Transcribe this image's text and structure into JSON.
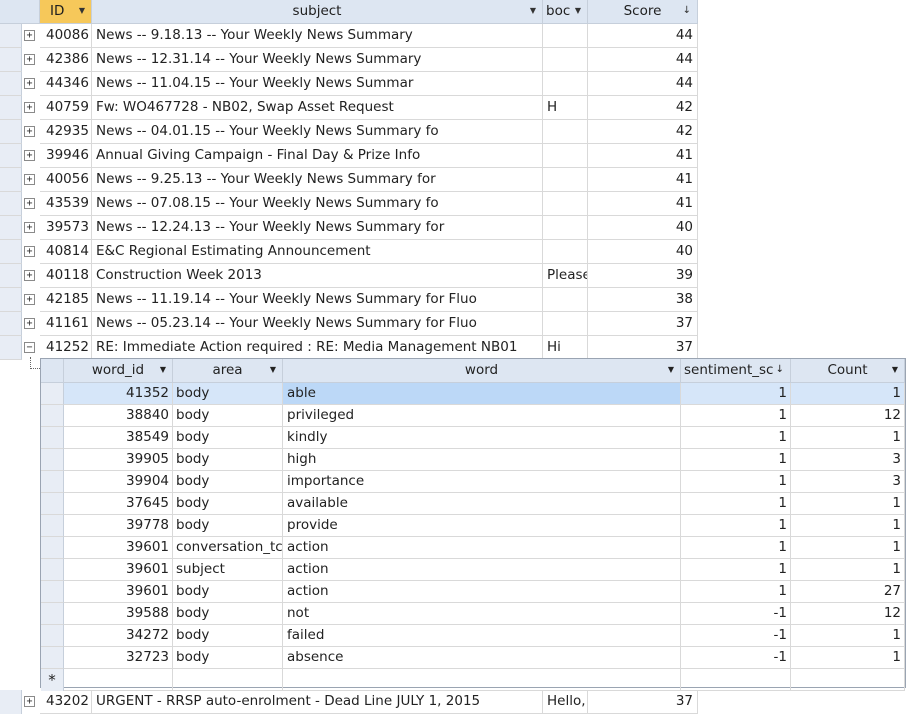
{
  "main": {
    "columns": [
      {
        "key": "id",
        "label": "ID",
        "sort": "▾"
      },
      {
        "key": "subject",
        "label": "subject",
        "sort": "▾"
      },
      {
        "key": "body",
        "label": "boc",
        "sort": "▾"
      },
      {
        "key": "score",
        "label": "Score",
        "sort": "↓"
      }
    ],
    "rows": [
      {
        "id": "40086",
        "subject": "News -- 9.18.13 -- Your Weekly News Summary",
        "body": "",
        "score": "44",
        "expander": "+"
      },
      {
        "id": "42386",
        "subject": "News -- 12.31.14 -- Your Weekly News Summary",
        "body": "",
        "score": "44",
        "expander": "+"
      },
      {
        "id": "44346",
        "subject": "News -- 11.04.15 -- Your Weekly News Summar",
        "body": "",
        "score": "44",
        "expander": "+"
      },
      {
        "id": "40759",
        "subject": "Fw: WO467728 - NB02, Swap Asset Request",
        "body": "H",
        "score": "42",
        "expander": "+"
      },
      {
        "id": "42935",
        "subject": "News -- 04.01.15 -- Your Weekly News Summary fo",
        "body": "",
        "score": "42",
        "expander": "+"
      },
      {
        "id": "39946",
        "subject": "Annual Giving Campaign - Final Day & Prize Info",
        "body": "",
        "score": "41",
        "expander": "+"
      },
      {
        "id": "40056",
        "subject": "News -- 9.25.13 -- Your Weekly News Summary for",
        "body": "",
        "score": "41",
        "expander": "+"
      },
      {
        "id": "43539",
        "subject": "News -- 07.08.15 -- Your Weekly News Summary fo",
        "body": "",
        "score": "41",
        "expander": "+"
      },
      {
        "id": "39573",
        "subject": "News -- 12.24.13 -- Your Weekly News Summary for",
        "body": "",
        "score": "40",
        "expander": "+"
      },
      {
        "id": "40814",
        "subject": "E&C Regional Estimating Announcement",
        "body": "",
        "score": "40",
        "expander": "+"
      },
      {
        "id": "40118",
        "subject": "Construction Week 2013",
        "body": "Please",
        "score": "39",
        "expander": "+"
      },
      {
        "id": "42185",
        "subject": "News -- 11.19.14 -- Your Weekly News Summary for Fluo",
        "body": "",
        "score": "38",
        "expander": "+"
      },
      {
        "id": "41161",
        "subject": "News -- 05.23.14 -- Your Weekly News Summary for Fluo",
        "body": "",
        "score": "37",
        "expander": "+"
      },
      {
        "id": "41252",
        "subject": "RE: Immediate Action required : RE: Media Management NB01",
        "body": "Hi",
        "score": "37",
        "expander": "−"
      }
    ],
    "last_row": {
      "id": "43202",
      "subject": "URGENT - RRSP auto-enrolment - Dead Line JULY 1, 2015",
      "body": "Hello,",
      "score": "37",
      "expander": "+"
    }
  },
  "sub": {
    "columns": [
      {
        "key": "word_id",
        "label": "word_id",
        "sort": "▾"
      },
      {
        "key": "area",
        "label": "area",
        "sort": "▾"
      },
      {
        "key": "word",
        "label": "word",
        "sort": "▾"
      },
      {
        "key": "sentiment",
        "label": "sentiment_sc",
        "sort": "↓"
      },
      {
        "key": "count",
        "label": "Count",
        "sort": "▾"
      }
    ],
    "rows": [
      {
        "word_id": "41352",
        "area": "body",
        "word": "able",
        "sentiment": "1",
        "count": "1"
      },
      {
        "word_id": "38840",
        "area": "body",
        "word": "privileged",
        "sentiment": "1",
        "count": "12"
      },
      {
        "word_id": "38549",
        "area": "body",
        "word": "kindly",
        "sentiment": "1",
        "count": "1"
      },
      {
        "word_id": "39905",
        "area": "body",
        "word": "high",
        "sentiment": "1",
        "count": "3"
      },
      {
        "word_id": "39904",
        "area": "body",
        "word": "importance",
        "sentiment": "1",
        "count": "3"
      },
      {
        "word_id": "37645",
        "area": "body",
        "word": "available",
        "sentiment": "1",
        "count": "1"
      },
      {
        "word_id": "39778",
        "area": "body",
        "word": "provide",
        "sentiment": "1",
        "count": "1"
      },
      {
        "word_id": "39601",
        "area": "conversation_tc",
        "word": "action",
        "sentiment": "1",
        "count": "1"
      },
      {
        "word_id": "39601",
        "area": "subject",
        "word": "action",
        "sentiment": "1",
        "count": "1"
      },
      {
        "word_id": "39601",
        "area": "body",
        "word": "action",
        "sentiment": "1",
        "count": "27"
      },
      {
        "word_id": "39588",
        "area": "body",
        "word": "not",
        "sentiment": "-1",
        "count": "12"
      },
      {
        "word_id": "34272",
        "area": "body",
        "word": "failed",
        "sentiment": "-1",
        "count": "1"
      },
      {
        "word_id": "32723",
        "area": "body",
        "word": "absence",
        "sentiment": "-1",
        "count": "1"
      }
    ],
    "new_row_marker": "*"
  },
  "colors": {
    "header": "#dde6f2",
    "header_selected": "#f6c85a",
    "selected_cell": "#bcd8f7",
    "gridline": "#d9d9d9"
  },
  "icons": {
    "expand": "plus-box-icon",
    "collapse": "minus-box-icon",
    "new_record": "asterisk-icon",
    "sort_arrow": "chevron-down-icon"
  }
}
